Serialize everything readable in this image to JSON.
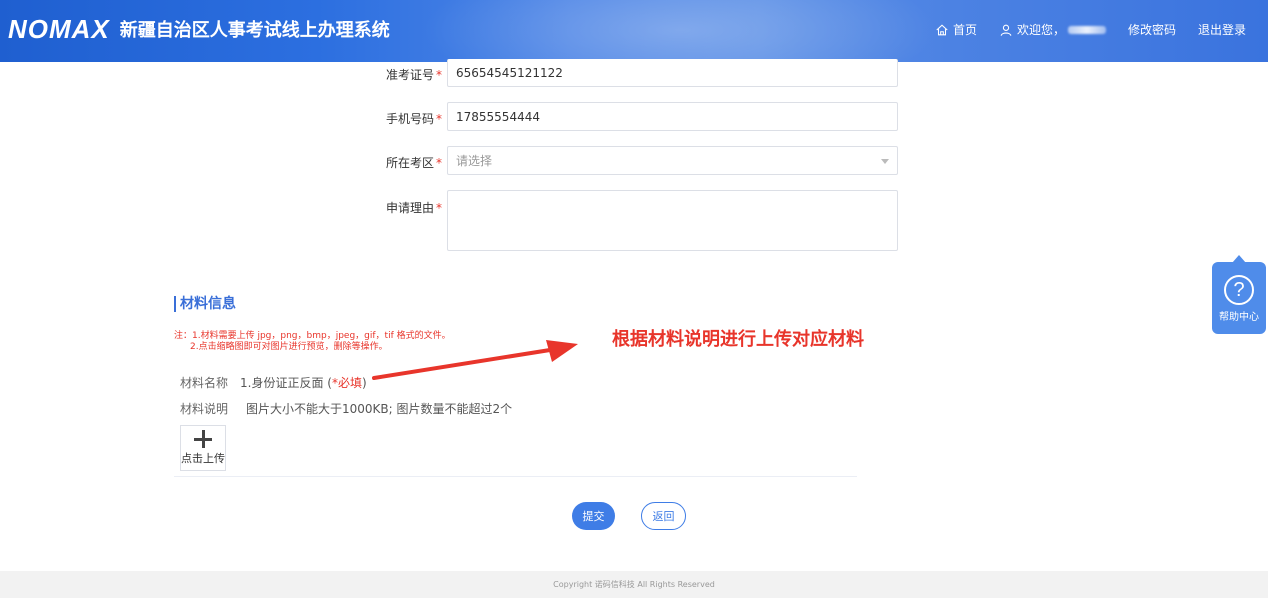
{
  "header": {
    "logo_text": "NOMAX",
    "system_title": "新疆自治区人事考试线上办理系统",
    "nav": {
      "home_label": "首页",
      "welcome_label": "欢迎您，",
      "change_password_label": "修改密码",
      "logout_label": "退出登录"
    }
  },
  "form": {
    "ticket": {
      "label": "准考证号",
      "value": "65654545121122"
    },
    "phone": {
      "label": "手机号码",
      "value": "17855554444"
    },
    "region": {
      "label": "所在考区",
      "placeholder": "请选择"
    },
    "reason": {
      "label": "申请理由",
      "value": ""
    },
    "required_mark": "*"
  },
  "materials": {
    "section_title": "材料信息",
    "note_line1": "注：1.材料需要上传 jpg，png，bmp，jpeg，gif，tif 格式的文件。",
    "note_line2": "2.点击缩略图即可对图片进行预览，删除等操作。",
    "name_label": "材料名称",
    "name_value": "1.身份证正反面",
    "name_required_open": " (",
    "name_required": "*必填",
    "name_required_close": ")",
    "desc_label": "材料说明",
    "desc_value": "图片大小不能大于1000KB; 图片数量不能超过2个",
    "upload_label": "点击上传"
  },
  "annotation": {
    "text": "根据材料说明进行上传对应材料",
    "color": "#e8352b"
  },
  "actions": {
    "submit_label": "提交",
    "back_label": "返回"
  },
  "help": {
    "label": "帮助中心",
    "symbol": "?"
  },
  "footer": {
    "copyright": "Copyright 诺码信科技 All Rights Reserved"
  },
  "colors": {
    "primary": "#3f7de6",
    "required": "#e8352b"
  }
}
